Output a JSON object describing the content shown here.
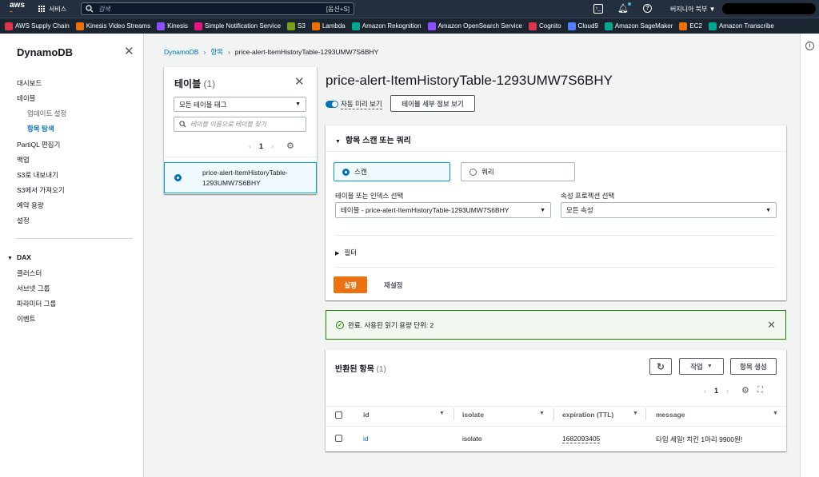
{
  "topbar": {
    "logo": "aws",
    "services_label": "서비스",
    "search_placeholder": "검색",
    "search_shortcut": "[옵션+S]",
    "region_label": "버지니아 북부 ▼"
  },
  "favorites": [
    {
      "label": "AWS Supply Chain",
      "color": "#dd344c"
    },
    {
      "label": "Kinesis Video Streams",
      "color": "#ed7100"
    },
    {
      "label": "Kinesis",
      "color": "#8c4fff"
    },
    {
      "label": "Simple Notification Service",
      "color": "#e7157b"
    },
    {
      "label": "S3",
      "color": "#7aa116"
    },
    {
      "label": "Lambda",
      "color": "#ed7100"
    },
    {
      "label": "Amazon Rekognition",
      "color": "#01a88d"
    },
    {
      "label": "Amazon OpenSearch Service",
      "color": "#8c4fff"
    },
    {
      "label": "Cognito",
      "color": "#dd344c"
    },
    {
      "label": "Cloud9",
      "color": "#527fff"
    },
    {
      "label": "Amazon SageMaker",
      "color": "#01a88d"
    },
    {
      "label": "EC2",
      "color": "#ed7100"
    },
    {
      "label": "Amazon Transcribe",
      "color": "#01a88d"
    }
  ],
  "sidenav": {
    "title": "DynamoDB",
    "items": [
      {
        "label": "대시보드"
      },
      {
        "label": "테이블"
      },
      {
        "label": "업데이트 설정"
      },
      {
        "label": "항목 탐색"
      },
      {
        "label": "PartiQL 편집기"
      },
      {
        "label": "백업"
      },
      {
        "label": "S3로 내보내기"
      },
      {
        "label": "S3에서 가져오기"
      },
      {
        "label": "예약 용량"
      },
      {
        "label": "설정"
      }
    ],
    "dax": {
      "title": "DAX",
      "items": [
        {
          "label": "클러스터"
        },
        {
          "label": "서브넷 그룹"
        },
        {
          "label": "파라미터 그룹"
        },
        {
          "label": "이벤트"
        }
      ]
    }
  },
  "breadcrumb": {
    "root": "DynamoDB",
    "mid": "항목",
    "current": "price-alert-ItemHistoryTable-1293UMW7S6BHY"
  },
  "tables_panel": {
    "title": "테이블",
    "count": "(1)",
    "tag_filter": "모든 테이블 태그",
    "search_placeholder": "테이블 이름으로 테이블 찾기",
    "page": "1",
    "items": [
      {
        "name_line1": "price-alert-ItemHistoryTable-",
        "name_line2": "1293UMW7S6BHY"
      }
    ]
  },
  "main": {
    "title": "price-alert-ItemHistoryTable-1293UMW7S6BHY",
    "auto_preview": "자동 미리 보기",
    "details_button": "테이블 세부 정보 보기"
  },
  "query": {
    "header": "항목 스캔 또는 쿼리",
    "scan_label": "스캔",
    "query_label": "쿼리",
    "index_label": "테이블 또는 인덱스 선택",
    "index_value": "테이블 - price-alert-ItemHistoryTable-1293UMW7S6BHY",
    "projection_label": "속성 프로젝션 선택",
    "projection_value": "모든 속성",
    "filter_label": "필터",
    "run_button": "실행",
    "reset_button": "재설정"
  },
  "alert": {
    "message": "완료. 사용된 읽기 용량 단위: 2"
  },
  "results": {
    "title": "반환된 항목",
    "count": "(1)",
    "actions_button": "작업",
    "create_button": "항목 생성",
    "page": "1",
    "columns": [
      "id",
      "isolate",
      "expiration (TTL)",
      "message"
    ],
    "rows": [
      {
        "id": "id",
        "isolate": "isolate",
        "expiration": "1682093405",
        "message": "타임 세일! 치킨 1마리 9900원!"
      }
    ]
  }
}
